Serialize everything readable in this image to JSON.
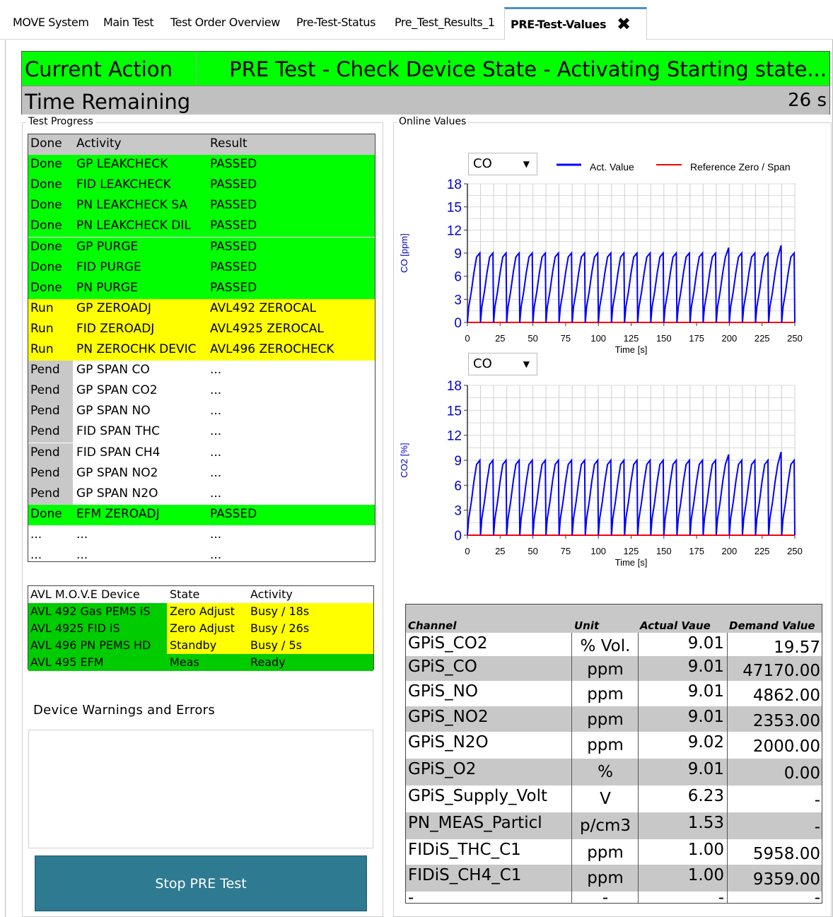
{
  "tabs": [
    "MOVE System",
    "Main Test",
    "Test Order Overview",
    "Pre-Test-Status",
    "Pre_Test_Results_1",
    "PRE-Test-Values"
  ],
  "banner": {
    "current_action_label": "Current Action",
    "current_action_value": "PRE Test - Check Device State - Activating Starting state...",
    "time_remaining_label": "Time Remaining",
    "time_remaining_value": "26 s"
  },
  "test_progress": {
    "title": "Test Progress",
    "headers": [
      "Done",
      "Activity",
      "Result"
    ],
    "rows": [
      {
        "state": "Done",
        "activity": "GP LEAKCHECK",
        "result": "PASSED",
        "color": "#00ff00"
      },
      {
        "state": "Done",
        "activity": "FID LEAKCHECK",
        "result": "PASSED",
        "color": "#00ff00"
      },
      {
        "state": "Done",
        "activity": "PN LEAKCHECK SA",
        "result": "PASSED",
        "color": "#00ff00"
      },
      {
        "state": "Done",
        "activity": "PN LEAKCHECK DIL",
        "result": "PASSED",
        "color": "#00ff00"
      },
      {
        "state": "Done",
        "activity": "GP PURGE",
        "result": "PASSED",
        "color": "#00ff00"
      },
      {
        "state": "Done",
        "activity": "FID PURGE",
        "result": "PASSED",
        "color": "#00ff00"
      },
      {
        "state": "Done",
        "activity": "PN PURGE",
        "result": "PASSED",
        "color": "#00ff00"
      },
      {
        "state": "Run",
        "activity": "GP ZEROADJ",
        "result": "AVL492 ZEROCAL",
        "color": "#ffff00"
      },
      {
        "state": "Run",
        "activity": "FID ZEROADJ",
        "result": "AVL4925 ZEROCAL",
        "color": "#ffff00"
      },
      {
        "state": "Run",
        "activity": "PN ZEROCHK DEVIC",
        "result": "AVL496 ZEROCHECK",
        "color": "#ffff00"
      },
      {
        "state": "Pend",
        "activity": "GP SPAN CO",
        "result": "...",
        "color": "#ffffff"
      },
      {
        "state": "Pend",
        "activity": "GP SPAN CO2",
        "result": "...",
        "color": "#ffffff"
      },
      {
        "state": "Pend",
        "activity": "GP SPAN NO",
        "result": "...",
        "color": "#ffffff"
      },
      {
        "state": "Pend",
        "activity": "FID SPAN THC",
        "result": "...",
        "color": "#ffffff"
      },
      {
        "state": "Pend",
        "activity": "FID SPAN CH4",
        "result": "...",
        "color": "#ffffff"
      },
      {
        "state": "Pend",
        "activity": "GP SPAN NO2",
        "result": "...",
        "color": "#ffffff"
      },
      {
        "state": "Pend",
        "activity": "GP SPAN N2O",
        "result": "...",
        "color": "#ffffff"
      },
      {
        "state": "Done",
        "activity": "EFM ZEROADJ",
        "result": "PASSED",
        "color": "#00ff00"
      },
      {
        "state": "...",
        "activity": "...",
        "result": "...",
        "color": "#ffffff"
      },
      {
        "state": "...",
        "activity": "...",
        "result": "...",
        "color": "#ffffff"
      }
    ]
  },
  "devices": {
    "headers": [
      "AVL M.O.V.E Device",
      "State",
      "Activity"
    ],
    "rows": [
      {
        "device": "AVL 492 Gas PEMS iS",
        "state": "Zero Adjust",
        "activity": "Busy / 18s",
        "state_color": "#ffff00"
      },
      {
        "device": "AVL 4925 FID iS",
        "state": "Zero Adjust",
        "activity": "Busy / 26s",
        "state_color": "#ffff00"
      },
      {
        "device": "AVL 496 PN PEMS HD",
        "state": "Standby",
        "activity": "Busy /  5s",
        "state_color": "#ffff00"
      },
      {
        "device": "AVL 495 EFM",
        "state": "Meas",
        "activity": "Ready",
        "state_color": "#00cc00"
      }
    ]
  },
  "warnings": {
    "title": "Device Warnings and Errors"
  },
  "stop_button": "Stop PRE Test",
  "online_values": {
    "title": "Online Values"
  },
  "legend": {
    "act_value": "Act. Value",
    "reference": "Reference Zero / Span"
  },
  "chart_data": [
    {
      "type": "line",
      "selector_value": "CO",
      "ylabel": "CO [ppm]",
      "xlabel": "Time [s]",
      "xlim": [
        0,
        250
      ],
      "ylim": [
        0,
        18
      ],
      "x_ticks": [
        0,
        25,
        50,
        75,
        100,
        125,
        150,
        175,
        200,
        225,
        250
      ],
      "y_ticks": [
        0,
        3,
        6,
        9,
        12,
        15,
        18
      ],
      "grid": true,
      "legend_position": "top",
      "series": [
        {
          "name": "Act. Value",
          "color": "#0000ff",
          "pattern": "sawtooth",
          "period_s": 10,
          "min": 0,
          "max": 9,
          "peaks": [
            {
              "x": 200,
              "y": 9.7
            },
            {
              "x": 240,
              "y": 10.0
            }
          ]
        },
        {
          "name": "Reference Zero / Span",
          "color": "#ff0000",
          "values": [
            0,
            0
          ],
          "x": [
            0,
            250
          ]
        }
      ]
    },
    {
      "type": "line",
      "selector_value": "CO",
      "ylabel": "CO2 [%]",
      "xlabel": "Time [s]",
      "xlim": [
        0,
        250
      ],
      "ylim": [
        0,
        18
      ],
      "x_ticks": [
        0,
        25,
        50,
        75,
        100,
        125,
        150,
        175,
        200,
        225,
        250
      ],
      "y_ticks": [
        0,
        3,
        6,
        9,
        12,
        15,
        18
      ],
      "grid": true,
      "series": [
        {
          "name": "Act. Value",
          "color": "#0000ff",
          "pattern": "sawtooth",
          "period_s": 10,
          "min": 0,
          "max": 9,
          "peaks": [
            {
              "x": 200,
              "y": 9.7
            },
            {
              "x": 240,
              "y": 10.0
            }
          ]
        },
        {
          "name": "Reference Zero / Span",
          "color": "#ff0000",
          "values": [
            0,
            0
          ],
          "x": [
            0,
            250
          ]
        }
      ]
    }
  ],
  "values_table": {
    "headers": [
      "Channel",
      "Unit",
      "Actual Vaue",
      "Demand Value"
    ],
    "rows": [
      {
        "channel": "GPiS_CO2",
        "unit": "% Vol.",
        "actual": "9.01",
        "demand": "19.57"
      },
      {
        "channel": "GPiS_CO",
        "unit": "ppm",
        "actual": "9.01",
        "demand": "47170.00"
      },
      {
        "channel": "GPiS_NO",
        "unit": "ppm",
        "actual": "9.01",
        "demand": "4862.00"
      },
      {
        "channel": "GPiS_NO2",
        "unit": "ppm",
        "actual": "9.01",
        "demand": "2353.00"
      },
      {
        "channel": "GPiS_N2O",
        "unit": "ppm",
        "actual": "9.02",
        "demand": "2000.00"
      },
      {
        "channel": "GPiS_O2",
        "unit": "%",
        "actual": "9.01",
        "demand": "0.00"
      },
      {
        "channel": "GPiS_Supply_Volt",
        "unit": "V",
        "actual": "6.23",
        "demand": "-"
      },
      {
        "channel": "PN_MEAS_Particl",
        "unit": "p/cm3",
        "actual": "1.53",
        "demand": "-"
      },
      {
        "channel": "FIDiS_THC_C1",
        "unit": "ppm",
        "actual": "1.00",
        "demand": "5958.00"
      },
      {
        "channel": "FIDiS_CH4_C1",
        "unit": "ppm",
        "actual": "1.00",
        "demand": "9359.00"
      },
      {
        "channel": "-",
        "unit": "-",
        "actual": "-",
        "demand": "-"
      }
    ]
  }
}
